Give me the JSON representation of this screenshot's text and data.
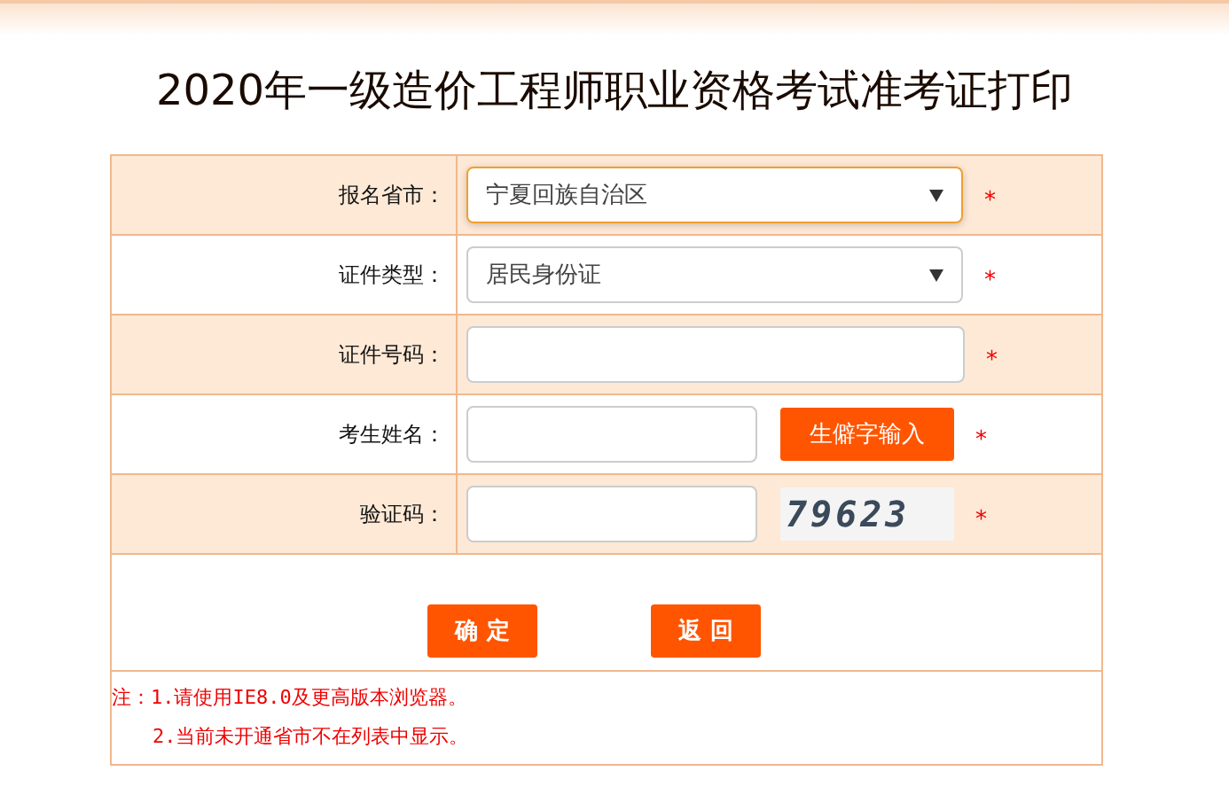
{
  "title": "2020年一级造价工程师职业资格考试准考证打印",
  "fields": [
    {
      "kind": "select",
      "label": "报名省市：",
      "value": "宁夏回族自治区",
      "focused": true,
      "required": "*"
    },
    {
      "kind": "select",
      "label": "证件类型：",
      "value": "居民身份证",
      "focused": false,
      "required": "*"
    },
    {
      "kind": "input",
      "label": "证件号码：",
      "focused": false,
      "required": "*"
    },
    {
      "kind": "input_button",
      "label": "考生姓名：",
      "focused": false,
      "button": "生僻字输入",
      "required": "*"
    },
    {
      "kind": "input_captcha",
      "label": "验证码：",
      "focused": false,
      "captcha": "79623",
      "required": "*"
    }
  ],
  "buttons": [
    "确 定",
    "返 回"
  ],
  "notes": [
    "注：1.请使用IE8.0及更高版本浏览器。",
    "2.当前未开通省市不在列表中显示。"
  ]
}
